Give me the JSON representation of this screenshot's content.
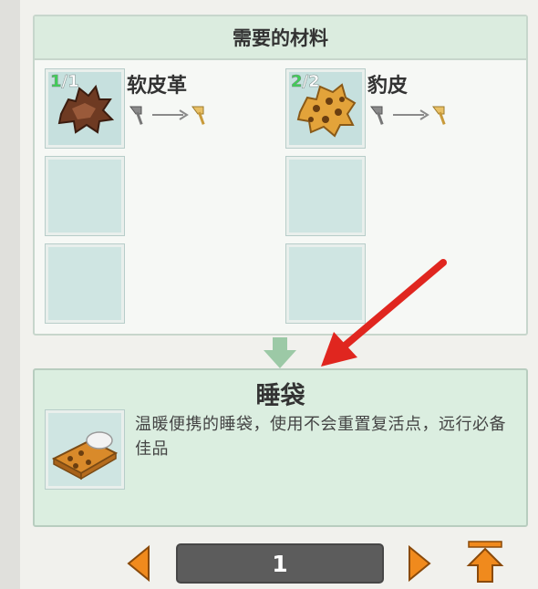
{
  "materials": {
    "header": "需要的材料",
    "items": [
      {
        "name": "软皮革",
        "have": "1",
        "need": "/1",
        "icon": "leather-icon"
      },
      {
        "name": "豹皮",
        "have": "2",
        "need": "/2",
        "icon": "leopard-hide-icon"
      }
    ],
    "empty_slots": 4
  },
  "result": {
    "title": "睡袋",
    "description": "温暖便携的睡袋，使用不会重置复活点，远行必备佳品",
    "icon": "sleeping-bag-icon"
  },
  "pager": {
    "page": "1"
  },
  "colors": {
    "accent_orange": "#f08a1d",
    "annotation_red": "#e0261f",
    "count_green": "#3fcf55"
  }
}
